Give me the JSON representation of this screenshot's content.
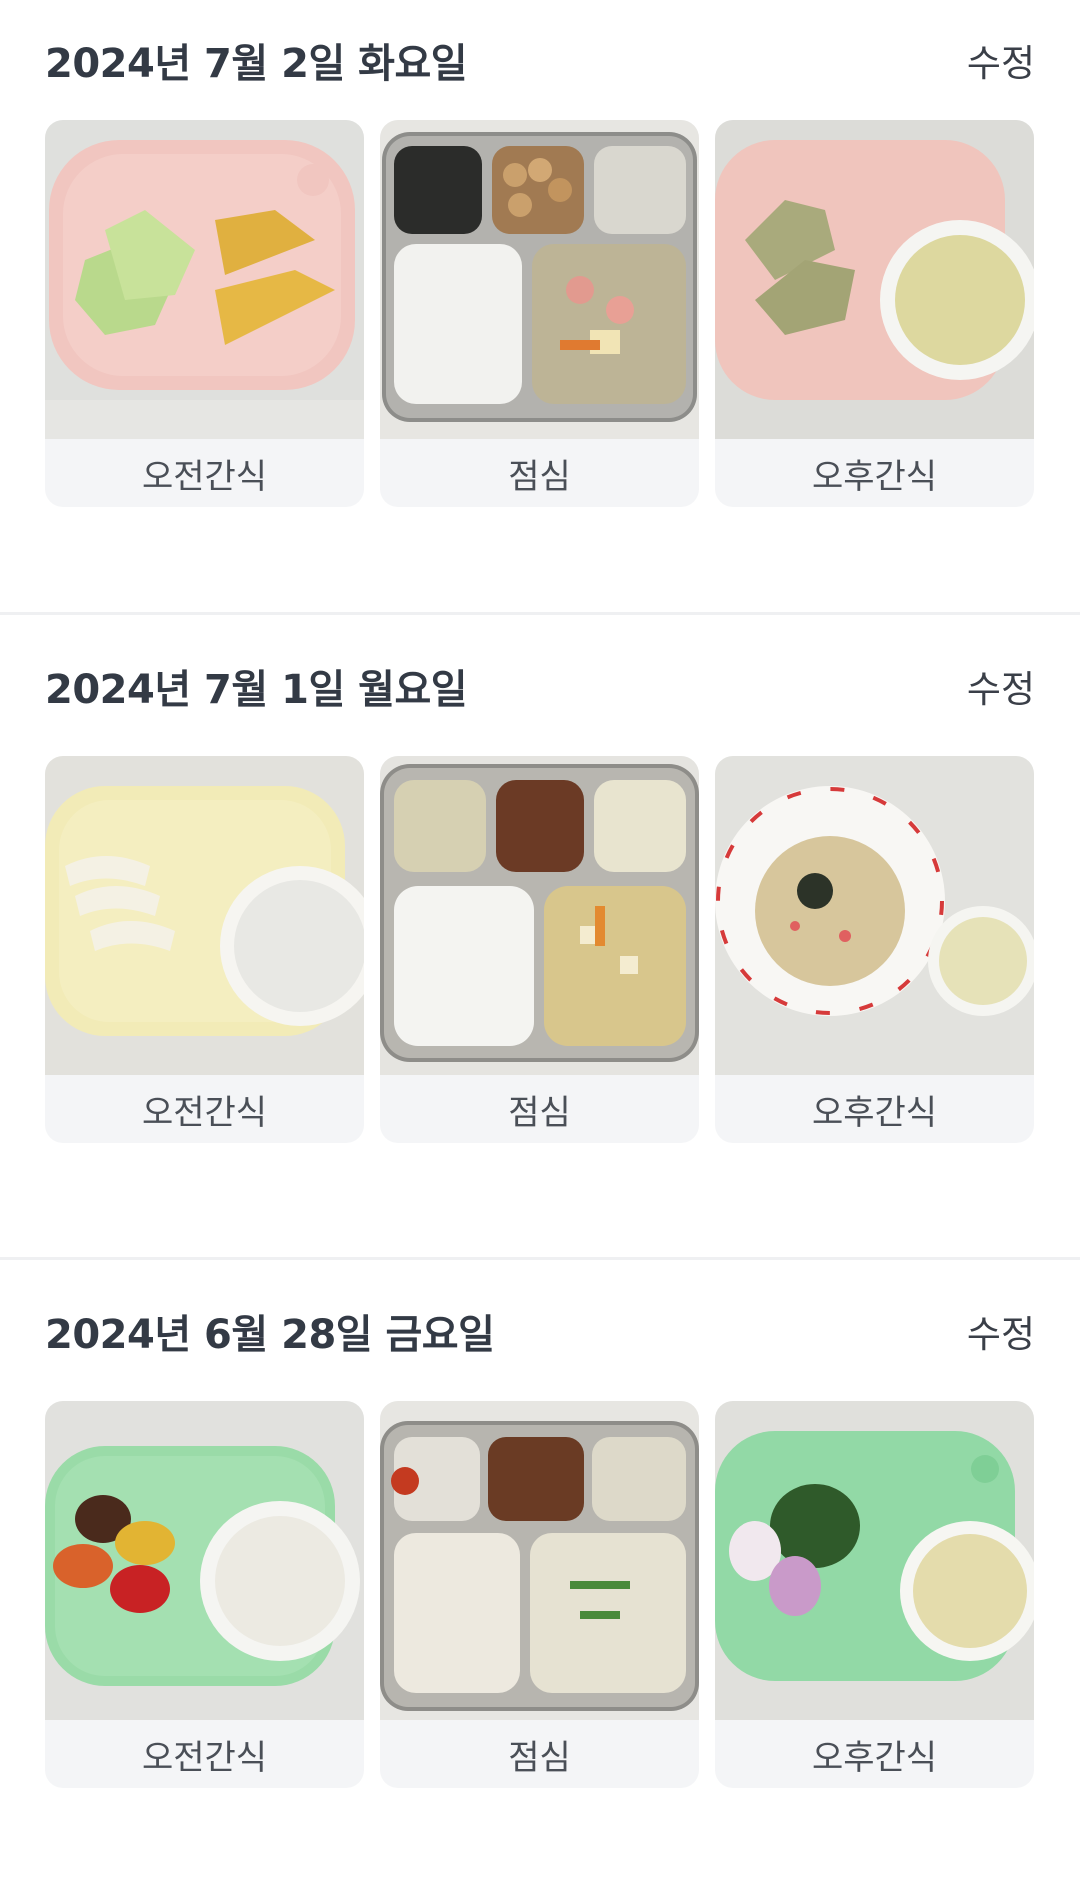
{
  "days": [
    {
      "title": "2024년 7월 2일 화요일",
      "edit_label": "수정",
      "meals": [
        {
          "label": "오전간식",
          "photo": "melon-and-pumpkin-snack-photo"
        },
        {
          "label": "점심",
          "photo": "rice-and-sausage-lunch-tray-photo"
        },
        {
          "label": "오후간식",
          "photo": "dumplings-and-tea-snack-photo"
        }
      ]
    },
    {
      "title": "2024년 7월 1일 월요일",
      "edit_label": "수정",
      "meals": [
        {
          "label": "오전간식",
          "photo": "sliced-pear-and-milk-snack-photo"
        },
        {
          "label": "점심",
          "photo": "rice-and-tofu-soup-lunch-tray-photo"
        },
        {
          "label": "오후간식",
          "photo": "fried-rice-and-tea-snack-photo"
        }
      ]
    },
    {
      "title": "2024년 6월 28일 금요일",
      "edit_label": "수정",
      "meals": [
        {
          "label": "오전간식",
          "photo": "cherry-tomatoes-and-milk-snack-photo"
        },
        {
          "label": "점심",
          "photo": "rice-and-tofu-stew-lunch-tray-photo"
        },
        {
          "label": "오후간식",
          "photo": "rice-cakes-and-tea-snack-photo"
        }
      ]
    }
  ]
}
